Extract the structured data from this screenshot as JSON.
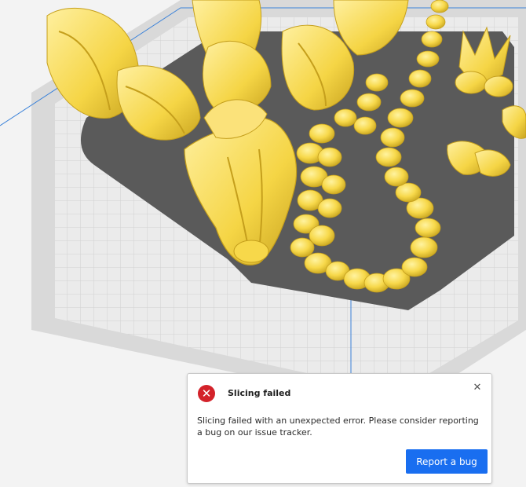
{
  "viewport": {
    "scene": "3d-build-plate-with-yellow-dragon-model",
    "model_color": "#f7d84a",
    "model_shadow_color": "#c8a51e",
    "plate_color": "#595959",
    "grid_color": "#c4c4c4",
    "background_color": "#f3f3f3",
    "axis_line_color": "#3b82d9"
  },
  "notification": {
    "icon": "error-icon",
    "icon_color": "#d3222a",
    "title": "Slicing failed",
    "close_icon": "close-icon",
    "close_glyph": "✕",
    "message": "Slicing failed with an unexpected error. Please consider reporting a bug on our issue tracker.",
    "button_label": "Report a bug",
    "button_color": "#196ef0"
  }
}
